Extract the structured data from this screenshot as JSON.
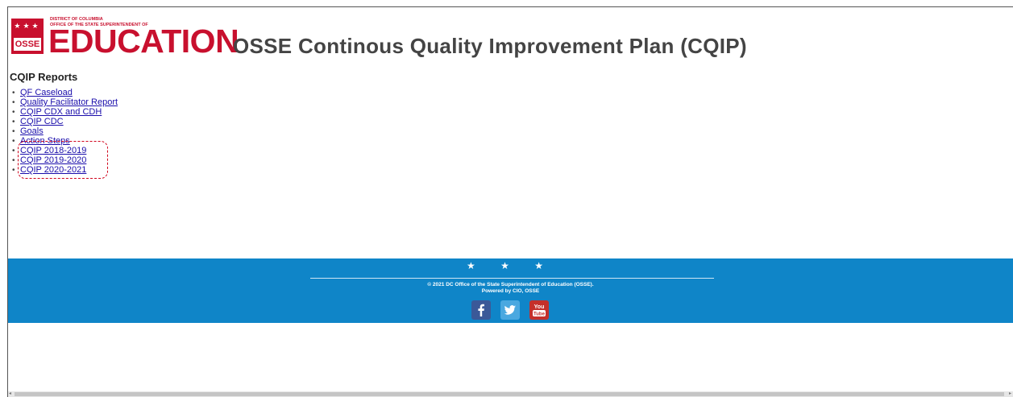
{
  "header": {
    "logo_small_line1": "DISTRICT OF COLUMBIA",
    "logo_small_line2": "OFFICE OF THE STATE SUPERINTENDENT OF",
    "logo_word": "EDUCATION",
    "logo_badge": "OSSE",
    "title": "OSSE Continous Quality Improvement Plan (CQIP)"
  },
  "reports": {
    "title": "CQIP Reports",
    "items": [
      {
        "label": "QF Caseload"
      },
      {
        "label": "Quality Facilitator Report"
      },
      {
        "label": "CQIP CDX and CDH"
      },
      {
        "label": "CQIP CDC"
      },
      {
        "label": "Goals"
      },
      {
        "label": "Action Steps"
      },
      {
        "label": "CQIP 2018-2019"
      },
      {
        "label": "CQIP 2019-2020"
      },
      {
        "label": "CQIP 2020-2021"
      }
    ]
  },
  "footer": {
    "stars": "★ ★ ★",
    "copyright": "© 2021 DC Office of the State Superintendent of Education (OSSE).",
    "powered_by": "Powered by CIO, OSSE",
    "social": [
      "facebook-icon",
      "twitter-icon",
      "youtube-icon"
    ],
    "youtube_text": "You Tube"
  },
  "colors": {
    "brand_red": "#c8102e",
    "footer_blue": "#0f85c8",
    "link": "#1a0dab",
    "highlight": "#d0021b"
  }
}
